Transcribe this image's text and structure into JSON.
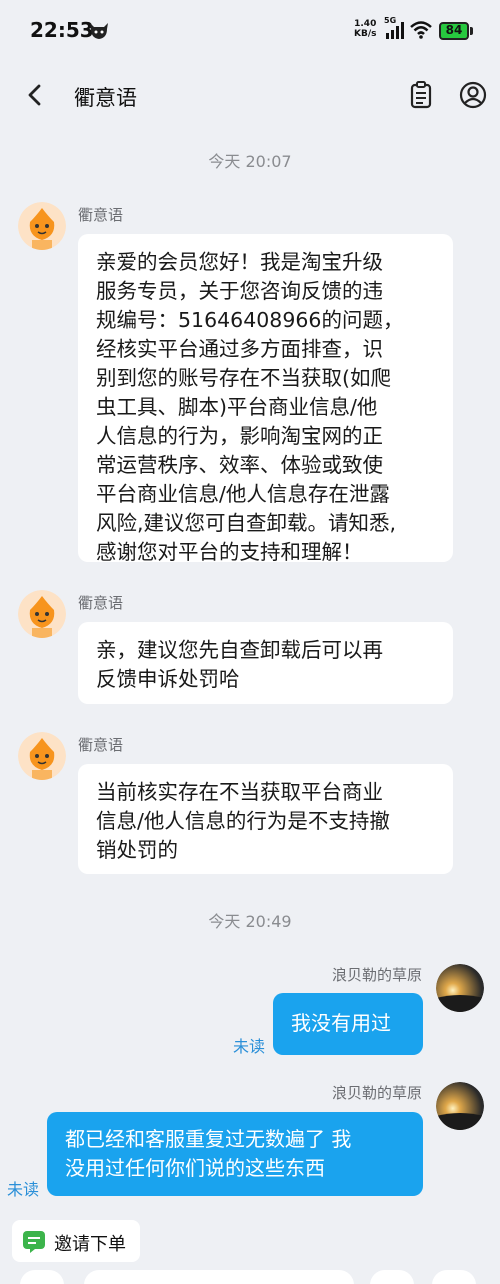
{
  "status_bar": {
    "time": "22:53",
    "net_speed_value": "1.40",
    "net_speed_unit": "KB/s",
    "network": "5G",
    "battery": "84",
    "battery_color": "#27c93f"
  },
  "header": {
    "title": "衢意语",
    "icons": [
      "back-icon",
      "order-list-icon",
      "user-icon"
    ]
  },
  "messages": {
    "time1": "今天  20:07",
    "m1_sender": "衢意语",
    "m1_lines": [
      "亲爱的会员您好！我是淘宝升级",
      "服务专员，关于您咨询反馈的违",
      "规编号：51646408966的问题，",
      "经核实平台通过多方面排查，识",
      "别到您的账号存在不当获取(如爬",
      "虫工具、脚本)平台商业信息/他",
      "人信息的行为，影响淘宝网的正",
      "常运营秩序、效率、体验或致使",
      "平台商业信息/他人信息存在泄露",
      "风险,建议您可自查卸载。请知悉,",
      "感谢您对平台的支持和理解！"
    ],
    "m2_sender": "衢意语",
    "m2_lines": [
      "亲，建议您先自查卸载后可以再",
      "反馈申诉处罚哈"
    ],
    "m3_sender": "衢意语",
    "m3_lines": [
      "当前核实存在不当获取平台商业",
      "信息/他人信息的行为是不支持撤",
      "销处罚的"
    ],
    "time2": "今天  20:49",
    "m4_sender": "浪贝勒的草原",
    "m4_text": "我没有用过",
    "m4_status": "未读",
    "m5_sender": "浪贝勒的草原",
    "m5_lines": [
      "都已经和客服重复过无数遍了 我",
      "没用过任何你们说的这些东西"
    ],
    "m5_status": "未读"
  },
  "footer": {
    "invite_label": "邀请下单",
    "accent_color": "#1aa3ee"
  }
}
